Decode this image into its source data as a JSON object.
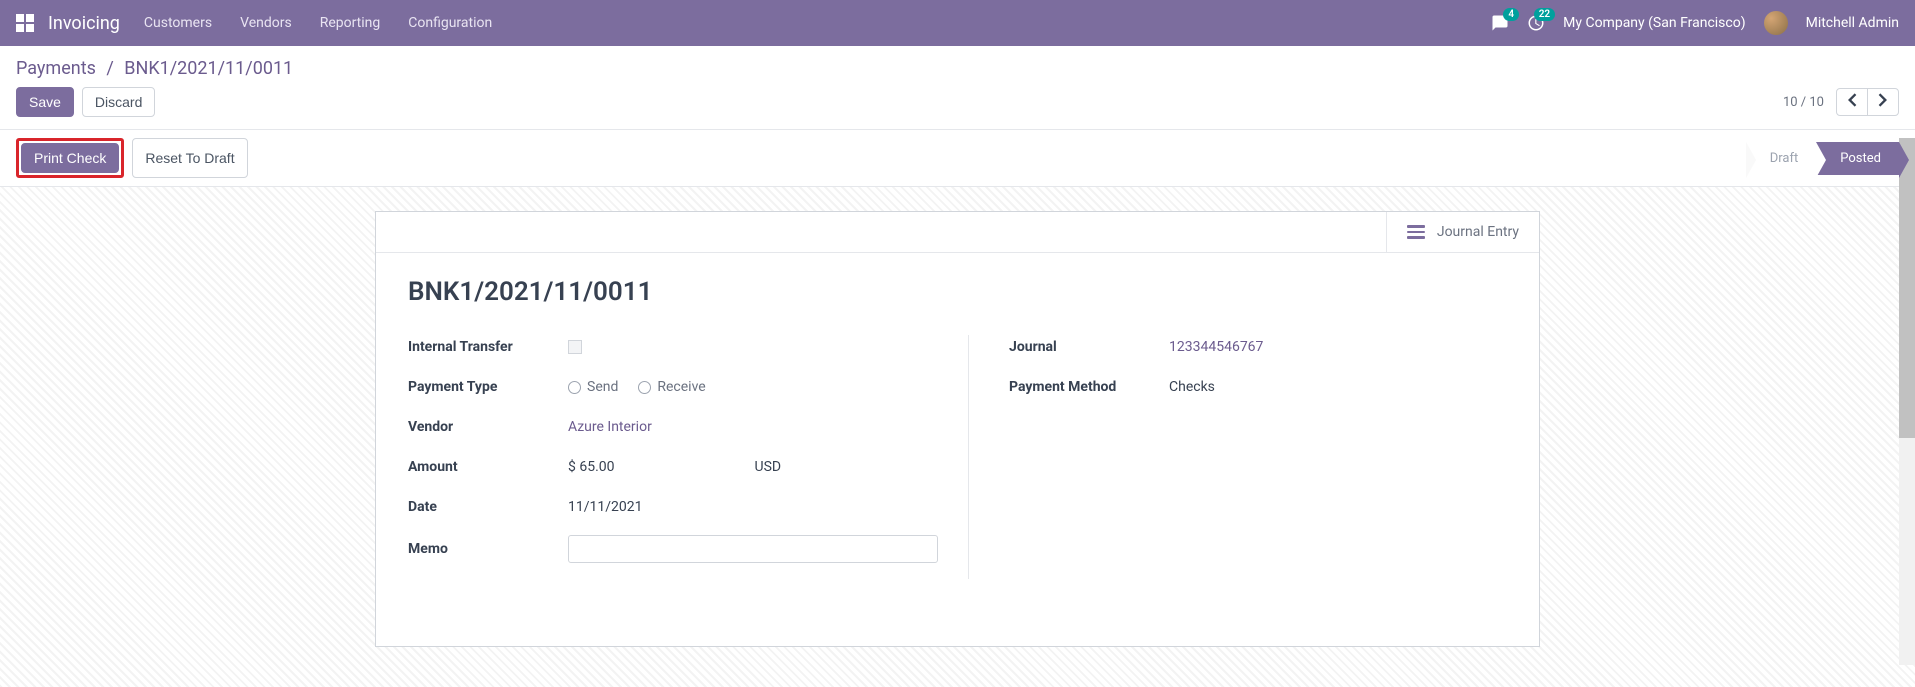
{
  "nav": {
    "brand": "Invoicing",
    "items": [
      "Customers",
      "Vendors",
      "Reporting",
      "Configuration"
    ],
    "chat_badge": "4",
    "activity_badge": "22",
    "company": "My Company (San Francisco)",
    "user": "Mitchell Admin"
  },
  "breadcrumb": {
    "parent": "Payments",
    "current": "BNK1/2021/11/0011"
  },
  "actions": {
    "save": "Save",
    "discard": "Discard",
    "pager": "10 / 10"
  },
  "statusbar": {
    "print_check": "Print Check",
    "reset_draft": "Reset To Draft",
    "draft": "Draft",
    "posted": "Posted"
  },
  "sheet": {
    "journal_entry": "Journal Entry",
    "title": "BNK1/2021/11/0011",
    "labels": {
      "internal_transfer": "Internal Transfer",
      "payment_type": "Payment Type",
      "vendor": "Vendor",
      "amount": "Amount",
      "date": "Date",
      "memo": "Memo",
      "journal": "Journal",
      "payment_method": "Payment Method"
    },
    "values": {
      "payment_type_send": "Send",
      "payment_type_receive": "Receive",
      "vendor": "Azure Interior",
      "amount": "$ 65.00",
      "currency": "USD",
      "date": "11/11/2021",
      "journal": "123344546767",
      "payment_method": "Checks"
    }
  }
}
